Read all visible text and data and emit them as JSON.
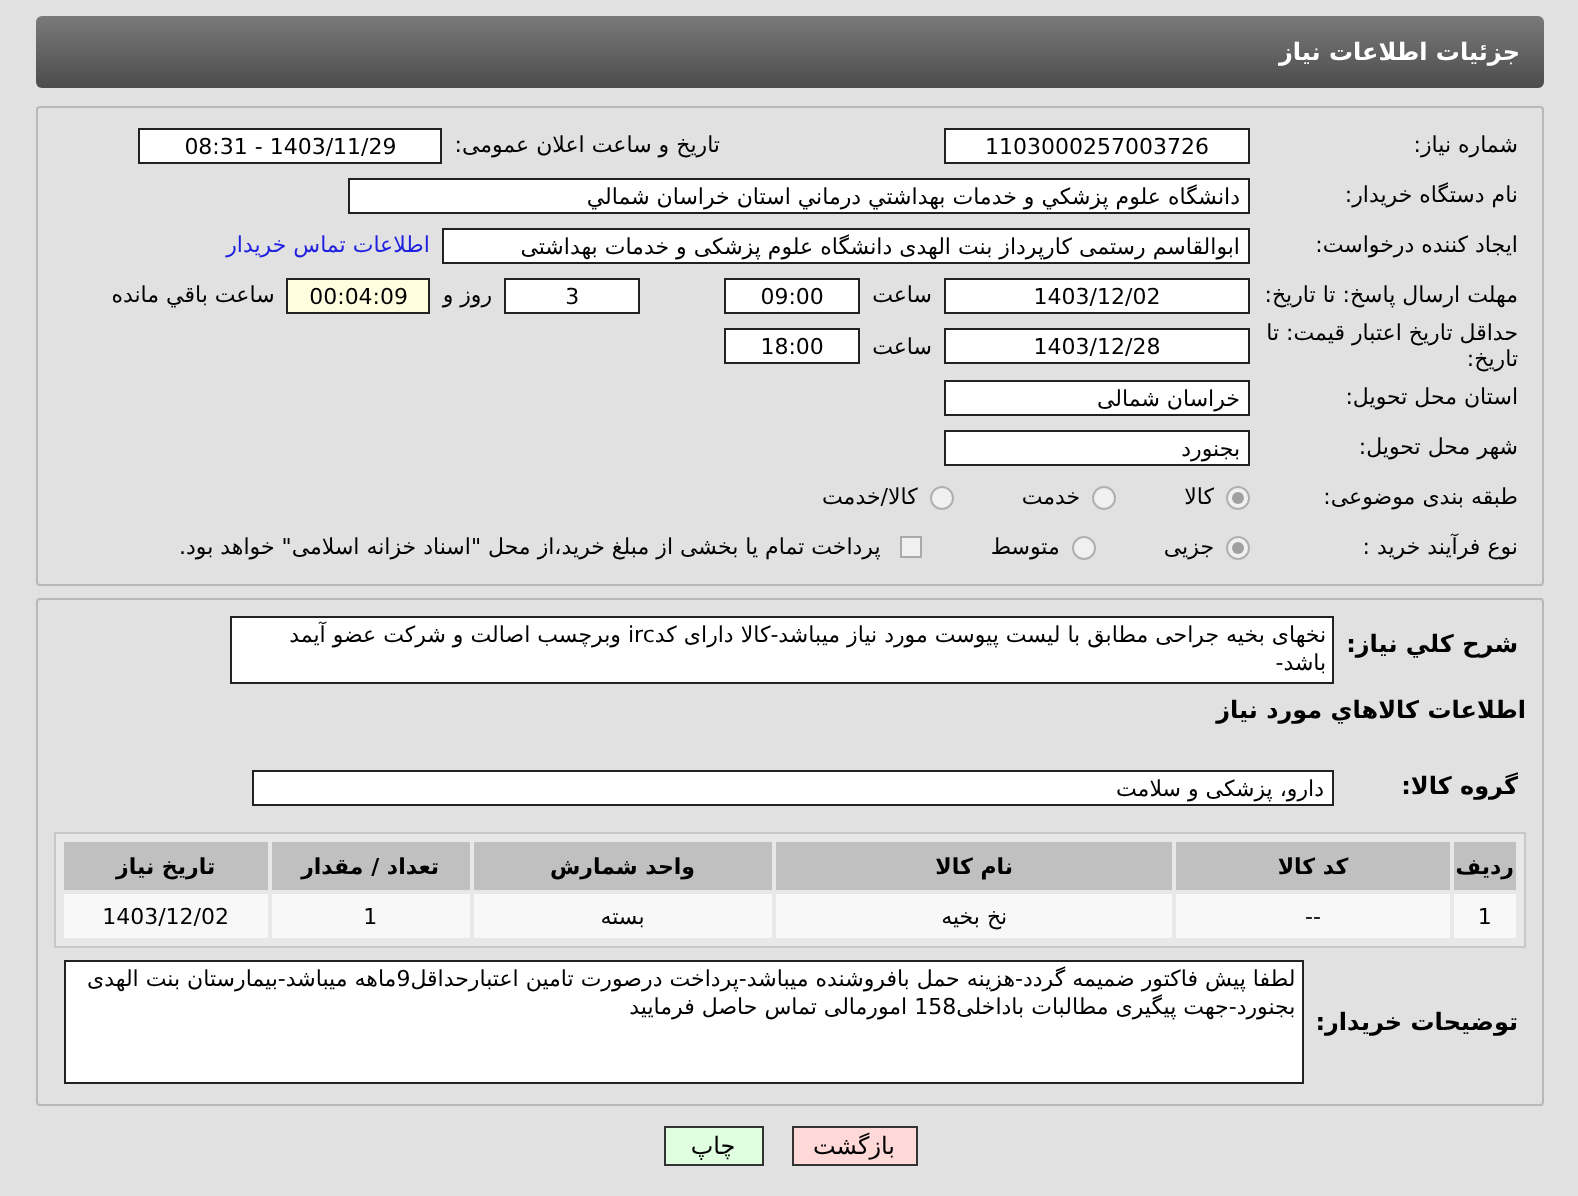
{
  "header": {
    "title": "جزئیات اطلاعات نیاز"
  },
  "need_number": {
    "label": "شماره نیاز:",
    "value": "1103000257003726"
  },
  "announce": {
    "label": "تاریخ و ساعت اعلان عمومی:",
    "value": "1403/11/29 - 08:31"
  },
  "buyer_org": {
    "label": "نام دستگاه خریدار:",
    "value": "دانشگاه علوم پزشکي و خدمات بهداشتي درماني استان خراسان شمالي"
  },
  "requester": {
    "label": "ایجاد کننده درخواست:",
    "value": "ابوالقاسم رستمی کارپرداز بنت الهدی دانشگاه علوم پزشکی و خدمات بهداشتی",
    "link": "اطلاعات تماس خریدار"
  },
  "deadline": {
    "label": "مهلت ارسال پاسخ: تا تاریخ:",
    "date": "1403/12/02",
    "time_label": "ساعت",
    "time": "09:00",
    "days": "3",
    "days_label": "روز و",
    "remaining": "00:04:09",
    "remaining_label": "ساعت باقي مانده"
  },
  "price_validity": {
    "label": "حداقل تاریخ اعتبار قیمت: تا تاریخ:",
    "date": "1403/12/28",
    "time_label": "ساعت",
    "time": "18:00"
  },
  "province": {
    "label": "استان محل تحویل:",
    "value": "خراسان شمالی"
  },
  "city": {
    "label": "شهر محل تحویل:",
    "value": "بجنورد"
  },
  "category": {
    "label": "طبقه بندی موضوعی:",
    "options": [
      {
        "label": "کالا",
        "selected": true
      },
      {
        "label": "خدمت",
        "selected": false
      },
      {
        "label": "کالا/خدمت",
        "selected": false
      }
    ]
  },
  "process": {
    "label": "نوع فرآیند خرید :",
    "options": [
      {
        "label": "جزیی",
        "selected": true
      },
      {
        "label": "متوسط",
        "selected": false
      }
    ],
    "payment_checkbox": {
      "label": "پرداخت تمام یا بخشی از مبلغ خرید،از محل \"اسناد خزانه اسلامی\" خواهد بود.",
      "checked": false
    }
  },
  "description": {
    "label": "شرح کلي نياز:",
    "value": "نخهای بخیه جراحی مطابق با لیست پیوست مورد نیاز میباشد-کالا دارای کدirc وبرچسب اصالت و شرکت عضو آیمد باشد-"
  },
  "goods_heading": "اطلاعات کالاهاي مورد نياز",
  "goods_group": {
    "label": "گروه کالا:",
    "value": "دارو، پزشکی و سلامت"
  },
  "table": {
    "columns": [
      "ردیف",
      "کد کالا",
      "نام کالا",
      "واحد شمارش",
      "تعداد / مقدار",
      "تاریخ نیاز"
    ],
    "rows": [
      [
        "1",
        "--",
        "نخ بخیه",
        "بسته",
        "1",
        "1403/12/02"
      ]
    ]
  },
  "buyer_notes": {
    "label": "توضیحات خریدار:",
    "value": "لطفا پیش فاکتور ضمیمه گردد-هزینه حمل بافروشنده میباشد-پرداخت درصورت تامین اعتبارحداقل9ماهه میباشد-بیمارستان بنت الهدی بجنورد-جهت پیگیری مطالبات باداخلی158 امورمالی تماس حاصل فرمایید"
  },
  "buttons": [
    {
      "kind": "back",
      "label": "بازگشت"
    },
    {
      "kind": "print",
      "label": "چاپ"
    }
  ]
}
